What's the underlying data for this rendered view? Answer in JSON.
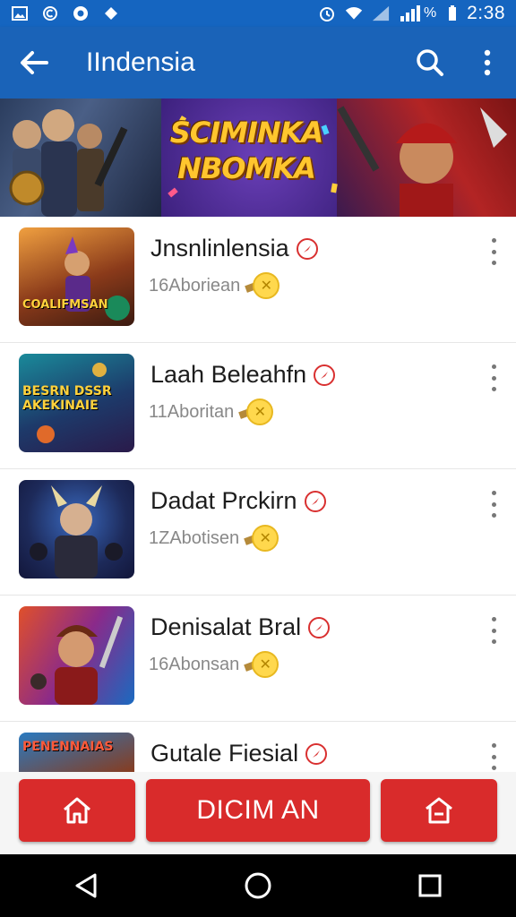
{
  "status_bar": {
    "time": "2:38",
    "battery_label": "%"
  },
  "app_bar": {
    "title": "IIndensia"
  },
  "banner": {
    "title": "SCIMINKA NBOMKA"
  },
  "items": [
    {
      "title": "Jnsnlinlensia",
      "subtitle": "16Aboriean",
      "thumb_text": "COALIFMSAN"
    },
    {
      "title": "Laah Beleahfn",
      "subtitle": "11Aboritan",
      "thumb_text": "BESRN DSSR AKEKINAIE"
    },
    {
      "title": "Dadat Prckirn",
      "subtitle": "1ZAbotisen",
      "thumb_text": ""
    },
    {
      "title": "Denisalat Bral",
      "subtitle": "16Abonsan",
      "thumb_text": ""
    },
    {
      "title": "Gutale Fiesial",
      "subtitle": "",
      "thumb_text": "PENENNAIAS"
    }
  ],
  "actions": {
    "main_label": "DICIM AN"
  },
  "colors": {
    "primary": "#1a63b8",
    "status": "#1565c0",
    "accent": "#d92b2b"
  }
}
